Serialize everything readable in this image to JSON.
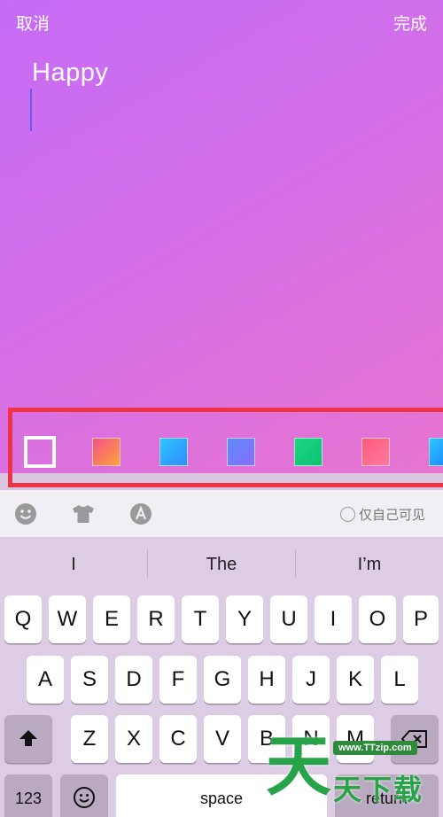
{
  "header": {
    "cancel_label": "取消",
    "done_label": "完成"
  },
  "composer": {
    "text": "Happy"
  },
  "toolbar": {
    "privacy_label": "仅自己可见"
  },
  "suggestions": [
    "I",
    "The",
    "I’m"
  ],
  "keyboard": {
    "row1": [
      "Q",
      "W",
      "E",
      "R",
      "T",
      "Y",
      "U",
      "I",
      "O",
      "P"
    ],
    "row2": [
      "A",
      "S",
      "D",
      "F",
      "G",
      "H",
      "J",
      "K",
      "L"
    ],
    "row3": [
      "Z",
      "X",
      "C",
      "V",
      "B",
      "N",
      "M"
    ],
    "numbers_label": "123",
    "space_label": "space",
    "return_label": "return"
  },
  "watermark": {
    "url": "www.TTzip.com",
    "big": "天",
    "text": "天下载"
  },
  "colors": {
    "editor_gradient": [
      "#c56cf5",
      "#e674d0"
    ],
    "highlight_border": "#f03247"
  }
}
